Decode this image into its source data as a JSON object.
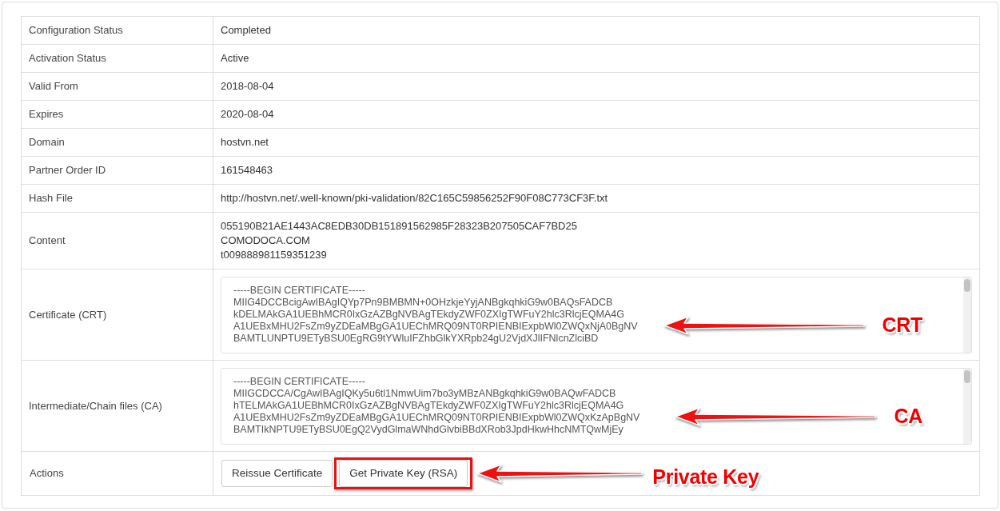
{
  "table": {
    "rows": [
      {
        "label": "Configuration Status",
        "kind": "text",
        "value": "Completed"
      },
      {
        "label": "Activation Status",
        "kind": "text",
        "value": "Active"
      },
      {
        "label": "Valid From",
        "kind": "text",
        "value": "2018-08-04"
      },
      {
        "label": "Expires",
        "kind": "text",
        "value": "2020-08-04"
      },
      {
        "label": "Domain",
        "kind": "text",
        "value": "hostvn.net"
      },
      {
        "label": "Partner Order ID",
        "kind": "text",
        "value": "161548463"
      },
      {
        "label": "Hash File",
        "kind": "text",
        "value": "http://hostvn.net/.well-known/pki-validation/82C165C59856252F90F08C773CF3F.txt"
      },
      {
        "label": "Content",
        "kind": "lines",
        "lines": [
          "055190B21AE1443AC8EDB30DB151891562985F28323B207505CAF7BD25",
          "COMODOCA.COM",
          "t009888981159351239"
        ]
      },
      {
        "label": "Certificate (CRT)",
        "kind": "textarea",
        "lines": [
          "-----BEGIN CERTIFICATE-----",
          "MIIG4DCCBcigAwIBAgIQYp7Pn9BMBMN+0OHzkjeYyjANBgkqhkiG9w0BAQsFADCB",
          "kDELMAkGA1UEBhMCR0IxGzAZBgNVBAgTEkdyZWF0ZXIgTWFuY2hlc3RlcjEQMA4G",
          "A1UEBxMHU2FsZm9yZDEaMBgGA1UEChMRQ09NT0RPIENBIExpbWl0ZWQxNjA0BgNV",
          "BAMTLUNPTU9ETyBSU0EgRG9tYWluIFZhbGlkYXRpb24gU2VjdXJlIFNlcnZlciBD"
        ],
        "callout": "CRT"
      },
      {
        "label": "Intermediate/Chain files (CA)",
        "kind": "textarea",
        "lines": [
          "-----BEGIN CERTIFICATE-----",
          "MIIGCDCCA/CgAwIBAgIQKy5u6tl1NmwUim7bo3yMBzANBgkqhkiG9w0BAQwFADCB",
          "hTELMAkGA1UEBhMCR0IxGzAZBgNVBAgTEkdyZWF0ZXIgTWFuY2hlc3RlcjEQMA4G",
          "A1UEBxMHU2FsZm9yZDEaMBgGA1UEChMRQ09NT0RPIENBIExpbWl0ZWQxKzApBgNV",
          "BAMTIkNPTU9ETyBSU0EgQ2VydGlmaWNhdGlvbiBBdXRob3JpdHkwHhcNMTQwMjEy"
        ],
        "callout": "CA"
      },
      {
        "label": "Actions",
        "kind": "buttons",
        "buttons": [
          {
            "label": "Reissue Certificate",
            "highlighted": false
          },
          {
            "label": "Get Private Key (RSA)",
            "highlighted": true
          }
        ],
        "callout": "Private Key"
      }
    ]
  }
}
